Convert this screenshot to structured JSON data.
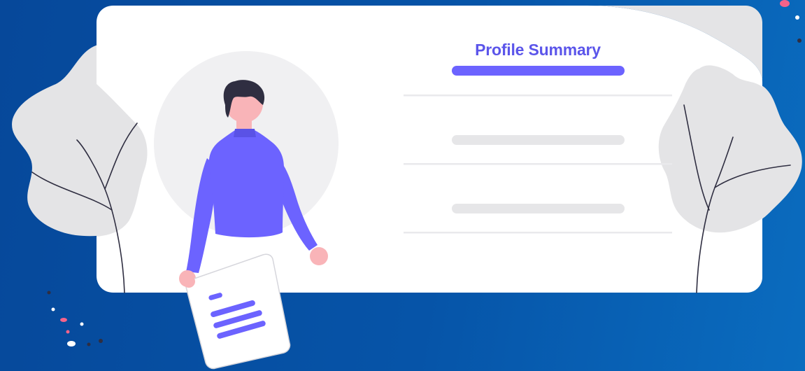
{
  "card": {
    "title": "Profile Summary"
  },
  "colors": {
    "background_start": "#06489a",
    "background_end": "#0a6cbf",
    "accent": "#6c63ff",
    "title": "#5b55ea",
    "card": "#ffffff",
    "foliage": "#e4e4e6",
    "skin": "#f9b4b8",
    "hair": "#2f2e41"
  },
  "icons": {
    "person": "person-illustration",
    "document": "document-icon",
    "plant": "plant-illustration"
  }
}
